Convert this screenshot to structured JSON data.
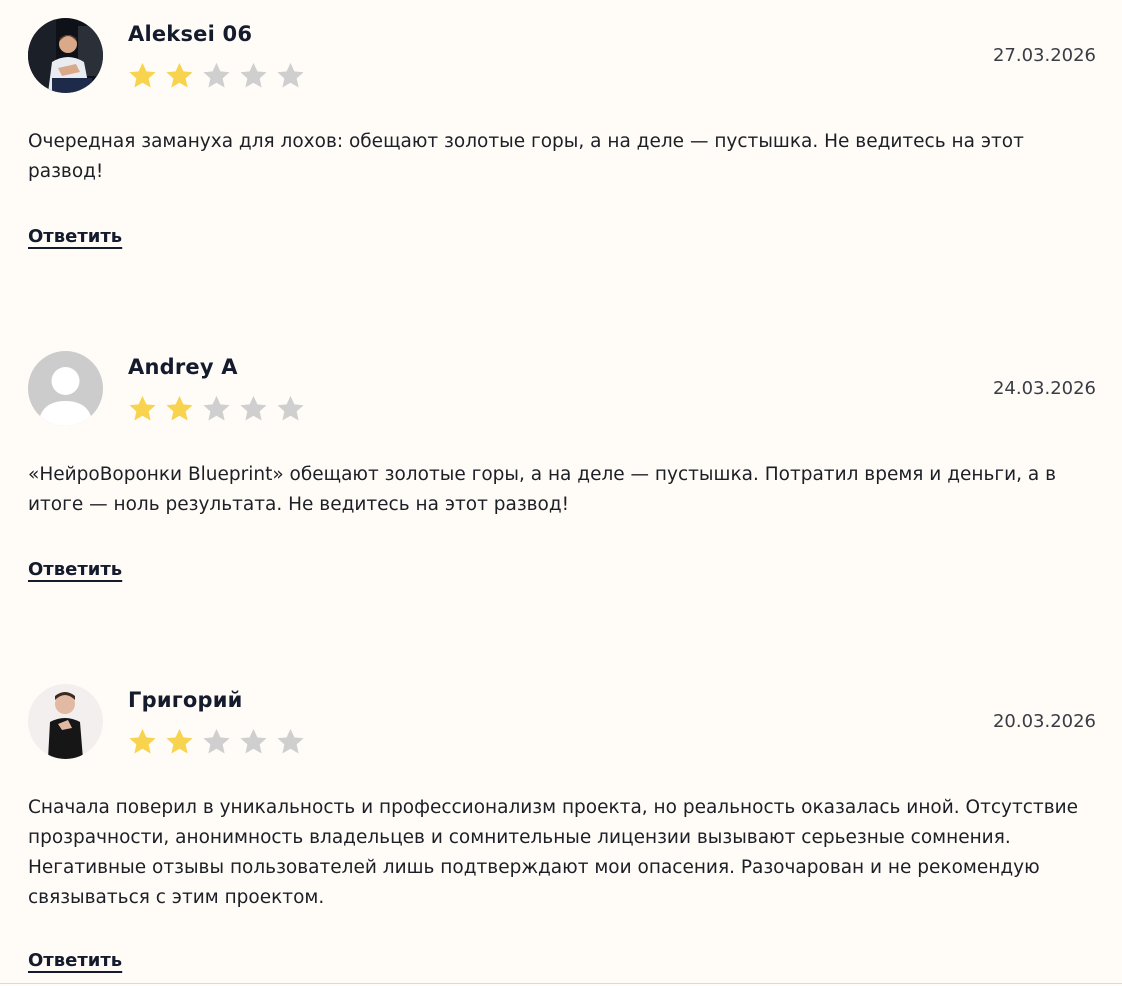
{
  "colors": {
    "background": "#fffbf7",
    "star_filled": "#f8d34d",
    "star_empty": "#cfcfcf",
    "text": "#1c1f26"
  },
  "reply_label": "Ответить",
  "reviews": [
    {
      "author": "Aleksei 06",
      "date": "27.03.2026",
      "rating": 2,
      "max_rating": 5,
      "avatar": "user-photo-icon",
      "text": "Очередная замануха для лохов: обещают золотые горы, а на деле — пустышка. Не ведитесь на этот развод!"
    },
    {
      "author": "Andrey A",
      "date": "24.03.2026",
      "rating": 2,
      "max_rating": 5,
      "avatar": "default-user-icon",
      "text": "«НейроВоронки Blueprint» обещают золотые горы, а на деле — пустышка. Потратил время и деньги, а в итоге — ноль результата. Не ведитесь на этот развод!"
    },
    {
      "author": "Григорий",
      "date": "20.03.2026",
      "rating": 2,
      "max_rating": 5,
      "avatar": "user-photo-icon",
      "text": "Сначала поверил в уникальность и профессионализм проекта, но реальность оказалась иной. Отсутствие прозрачности, анонимность владельцев и сомнительные лицензии вызывают серьезные сомнения. Негативные отзывы пользователей лишь подтверждают мои опасения. Разочарован и не рекомендую связываться с этим проектом."
    }
  ]
}
